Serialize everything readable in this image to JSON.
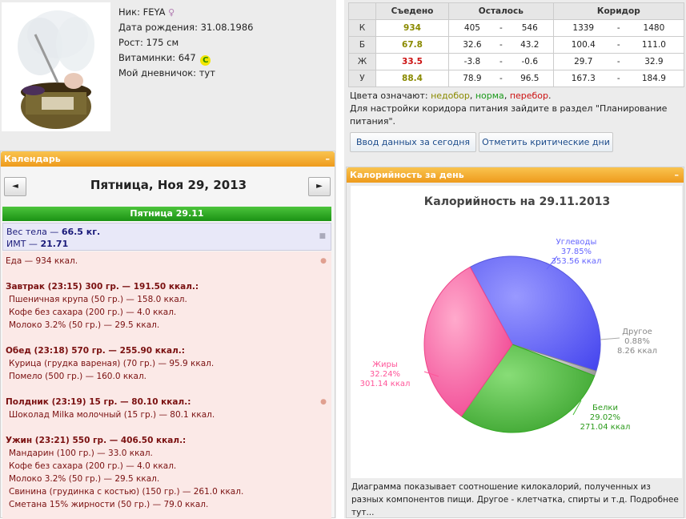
{
  "profile": {
    "nick_label": "Ник:",
    "nick": "FEYA",
    "dob_label": "Дата рождения:",
    "dob": "31.08.1986",
    "height_label": "Рост:",
    "height": "175 см",
    "vitamins_label": "Витаминки:",
    "vitamins": "647",
    "vitamins_badge": "C",
    "diary_label": "Мой дневничок:",
    "diary": "тут"
  },
  "ruler": {
    "headers": [
      "Съедено",
      "Осталось",
      "Коридор"
    ],
    "rows": [
      {
        "label": "К",
        "eaten": "934",
        "eaten_color": "#8a8a00",
        "left_min": "405",
        "left_max": "546",
        "cor_min": "1339",
        "cor_max": "1480"
      },
      {
        "label": "Б",
        "eaten": "67.8",
        "eaten_color": "#8a8a00",
        "left_min": "32.6",
        "left_max": "43.2",
        "cor_min": "100.4",
        "cor_max": "111.0"
      },
      {
        "label": "Ж",
        "eaten": "33.5",
        "eaten_color": "#cc1111",
        "left_min": "-3.8",
        "left_max": "-0.6",
        "cor_min": "29.7",
        "cor_max": "32.9"
      },
      {
        "label": "У",
        "eaten": "88.4",
        "eaten_color": "#8a8a00",
        "left_min": "78.9",
        "left_max": "96.5",
        "cor_min": "167.3",
        "cor_max": "184.9"
      }
    ],
    "dash": "-",
    "legend_prefix": "Цвета означают:",
    "legend_under": "недобор",
    "legend_norm": "норма",
    "legend_over": "перебор",
    "setup_text": "Для настройки коридора питания зайдите в раздел \"Планирование питания\".",
    "btn_input": "Ввод данных за сегодня",
    "btn_critical": "Отметить критические дни"
  },
  "calendar": {
    "title": "Календарь",
    "minimize": "–",
    "prev": "◄",
    "next": "►",
    "date_title": "Пятница, Ноя 29, 2013",
    "day_header": "Пятница 29.11",
    "weight_label": "Вес тела — ",
    "weight": "66.5 кг.",
    "bmi_label": "ИМТ — ",
    "bmi": "21.71",
    "food_total": "Еда — 934 ккал.",
    "meals": [
      {
        "header": "Завтрак (23:15) 300 гр. — 191.50 ккал.:",
        "items": [
          "Пшеничная крупа (50 гр.) — 158.0 ккал.",
          "Кофе без сахара (200 гр.) — 4.0 ккал.",
          "Молоко 3.2% (50 гр.) — 29.5 ккал."
        ]
      },
      {
        "header": "Обед (23:18) 570 гр. — 255.90 ккал.:",
        "items": [
          "Курица (грудка вареная) (70 гр.) — 95.9 ккал.",
          "Помело (500 гр.) — 160.0 ккал."
        ]
      },
      {
        "header": "Полдник (23:19) 15 гр. — 80.10 ккал.:",
        "items": [
          "Шоколад Milka молочный (15 гр.) — 80.1 ккал."
        ]
      },
      {
        "header": "Ужин (23:21) 550 гр. — 406.50 ккал.:",
        "items": [
          "Мандарин (100 гр.) — 33.0 ккал.",
          "Кофе без сахара (200 гр.) — 4.0 ккал.",
          "Молоко 3.2% (50 гр.) — 29.5 ккал.",
          "Свинина (грудинка с костью) (150 гр.) — 261.0 ккал.",
          "Сметана 15% жирности (50 гр.) — 79.0 ккал."
        ]
      }
    ]
  },
  "kcal_panel": {
    "title": "Калорийность за день",
    "minimize": "–",
    "note": "Диаграмма показывает соотношение килокалорий, полученных из разных компонентов пищи. Другое - клетчатка, спирты и т.д. Подробнее тут..."
  },
  "chart_data": {
    "type": "pie",
    "title": "Калорийность на 29.11.2013",
    "slices": [
      {
        "name": "Углеводы",
        "percent": "37.85%",
        "value": "353.56 ккал",
        "pct_num": 37.85,
        "color": "#6666ff"
      },
      {
        "name": "Другое",
        "percent": "0.88%",
        "value": "8.26 ккал",
        "pct_num": 0.88,
        "color": "#aaaaaa"
      },
      {
        "name": "Белки",
        "percent": "29.02%",
        "value": "271.04 ккал",
        "pct_num": 29.02,
        "color": "#44bb33"
      },
      {
        "name": "Жиры",
        "percent": "32.24%",
        "value": "301.14 ккал",
        "pct_num": 32.24,
        "color": "#ff5599"
      }
    ]
  }
}
